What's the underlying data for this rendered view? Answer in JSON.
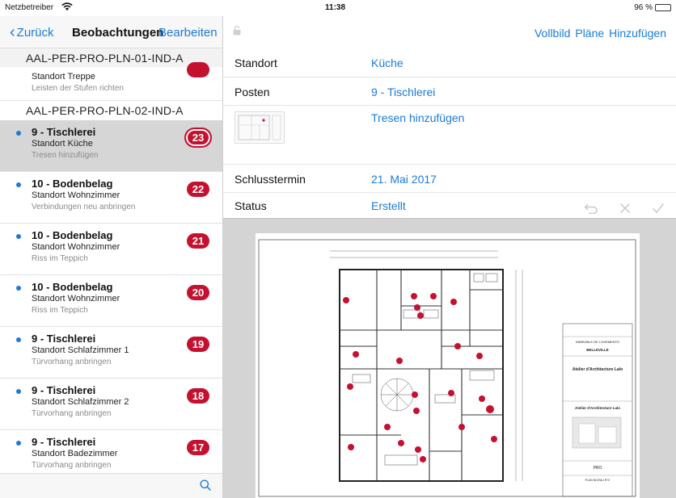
{
  "statusbar": {
    "carrier": "Netzbetreiber",
    "time": "11:38",
    "battery": "96 %",
    "battery_level": 0.96
  },
  "left_nav": {
    "back_label": "Zurück",
    "title": "Beobachtungen",
    "edit_label": "Bearbeiten"
  },
  "list": {
    "group1": "AAL-PER-PRO-PLN-01-IND-A",
    "partial_item": {
      "location": "Standort Treppe",
      "description": "Leisten der Stufen richten"
    },
    "group2": "AAL-PER-PRO-PLN-02-IND-A",
    "items": [
      {
        "title": "9 - Tischlerei",
        "location": "Standort Küche",
        "description": "Tresen hinzufügen",
        "badge": "23"
      },
      {
        "title": "10 - Bodenbelag",
        "location": "Standort Wohnzimmer",
        "description": "Verbindungen neu anbringen",
        "badge": "22"
      },
      {
        "title": "10 - Bodenbelag",
        "location": "Standort Wohnzimmer",
        "description": "Riss im Teppich",
        "badge": "21"
      },
      {
        "title": "10 - Bodenbelag",
        "location": "Standort Wohnzimmer",
        "description": "Riss im Teppich",
        "badge": "20"
      },
      {
        "title": "9 - Tischlerei",
        "location": "Standort Schlafzimmer 1",
        "description": "Türvorhang anbringen",
        "badge": "19"
      },
      {
        "title": "9 - Tischlerei",
        "location": "Standort Schlafzimmer 2",
        "description": "Türvorhang anbringen",
        "badge": "18"
      },
      {
        "title": "9 - Tischlerei",
        "location": "Standort Badezimmer",
        "description": "Türvorhang anbringen",
        "badge": "17"
      }
    ]
  },
  "right_nav": {
    "fullscreen_label": "Vollbild",
    "plans_label": "Pläne",
    "add_label": "Hinzufügen"
  },
  "detail": {
    "standort_label": "Standort",
    "standort_value": "Küche",
    "posten_label": "Posten",
    "posten_value": "9 - Tischlerei",
    "description_value": "Tresen hinzufügen",
    "deadline_label": "Schlusstermin",
    "deadline_value": "21. Mai 2017",
    "status_label": "Status",
    "status_value": "Erstellt"
  },
  "plan": {
    "project": "IMMEUBLE DE LOGEMENTS",
    "city": "BELLEVILLE",
    "architect": "Atelier d'Architecture Lalo",
    "phase": "PRO",
    "level": "PLAN NIVEAU R+2"
  },
  "colors": {
    "accent": "#1a7bd8",
    "badge": "#c51130",
    "selected_row": "#d6d6d6"
  }
}
